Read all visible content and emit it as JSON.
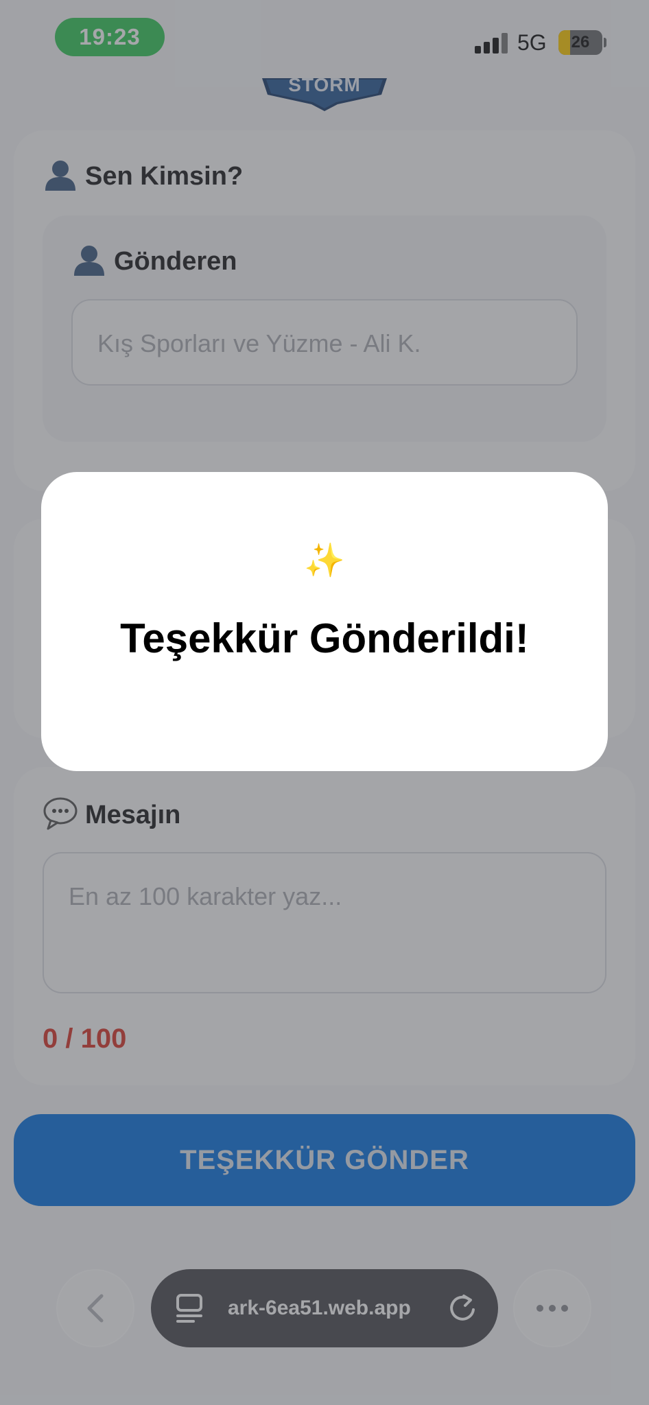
{
  "status_bar": {
    "time": "19:23",
    "network": "5G",
    "battery_level": "26"
  },
  "logo": {
    "text": "STORM"
  },
  "sender_section": {
    "title_icon": "bust-silhouette-icon",
    "title": "Sen Kimsin?",
    "inner_title_icon": "bust-silhouette-icon",
    "inner_title": "Gönderen",
    "input_placeholder": "Kış Sporları ve Yüzme - Ali K."
  },
  "message_section": {
    "title_icon": "speech-bubble-icon",
    "title": "Mesajın",
    "textarea_placeholder": "En az 100 karakter yaz...",
    "counter": "0 / 100"
  },
  "submit": {
    "label": "TEŞEKKÜR GÖNDER"
  },
  "browser_bar": {
    "url": "ark-6ea51.web.app"
  },
  "modal": {
    "icon": "sparkles-icon",
    "icon_glyph": "✨",
    "title": "Teşekkür Gönderildi!"
  },
  "colors": {
    "accent": "#0a74e0",
    "counter_red": "#d9372b",
    "status_green": "#34c759"
  }
}
